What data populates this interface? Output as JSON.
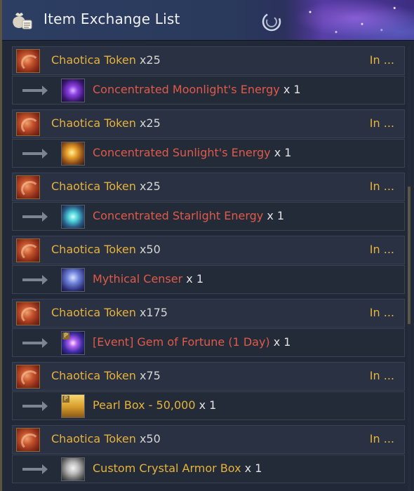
{
  "window": {
    "title": "Item Exchange List",
    "icons": {
      "title": "money-bag-scroll-icon",
      "refresh": "swirl-icon"
    }
  },
  "colors": {
    "gold_text": "#e6b33c",
    "reward_red": "#e05a4a",
    "reward_gold": "#e6b33c",
    "quantity_text": "#e4e4e4",
    "row_bg": "#262d3c",
    "title_bg": "#2c3e63"
  },
  "entries": [
    {
      "cost": {
        "name": "Chaotica Token",
        "qty": "x25",
        "icon": "chaotica-token-icon"
      },
      "status": "In ...",
      "arrow_icon": "arrow-right-icon",
      "reward": {
        "name": "Concentrated Moonlight's Energy",
        "qty": "x 1",
        "icon": "moonlight-energy-icon",
        "color": "#e05a4a"
      }
    },
    {
      "cost": {
        "name": "Chaotica Token",
        "qty": "x25",
        "icon": "chaotica-token-icon"
      },
      "status": "In ...",
      "arrow_icon": "arrow-right-icon",
      "reward": {
        "name": "Concentrated Sunlight's Energy",
        "qty": "x 1",
        "icon": "sunlight-energy-icon",
        "color": "#e05a4a"
      }
    },
    {
      "cost": {
        "name": "Chaotica Token",
        "qty": "x25",
        "icon": "chaotica-token-icon"
      },
      "status": "In ...",
      "arrow_icon": "arrow-right-icon",
      "reward": {
        "name": "Concentrated Starlight Energy",
        "qty": "x 1",
        "icon": "starlight-energy-icon",
        "color": "#e05a4a"
      }
    },
    {
      "cost": {
        "name": "Chaotica Token",
        "qty": "x50",
        "icon": "chaotica-token-icon"
      },
      "status": "In ...",
      "arrow_icon": "arrow-right-icon",
      "reward": {
        "name": "Mythical Censer",
        "qty": "x 1",
        "icon": "censer-icon",
        "color": "#e05a4a"
      }
    },
    {
      "cost": {
        "name": "Chaotica Token",
        "qty": "x175",
        "icon": "chaotica-token-icon"
      },
      "status": "In ...",
      "arrow_icon": "arrow-right-icon",
      "reward": {
        "name": "[Event] Gem of Fortune (1 Day)",
        "qty": "x 1",
        "icon": "gem-of-fortune-icon",
        "color": "#e05a4a",
        "badge": "P"
      }
    },
    {
      "cost": {
        "name": "Chaotica Token",
        "qty": "x75",
        "icon": "chaotica-token-icon"
      },
      "status": "In ...",
      "arrow_icon": "arrow-right-icon",
      "reward": {
        "name": "Pearl Box - 50,000",
        "qty": "x 1",
        "icon": "pearl-box-icon",
        "color": "#e6b33c",
        "badge": "P"
      }
    },
    {
      "cost": {
        "name": "Chaotica Token",
        "qty": "x50",
        "icon": "chaotica-token-icon"
      },
      "status": "In ...",
      "arrow_icon": "arrow-right-icon",
      "reward": {
        "name": "Custom Crystal Armor Box",
        "qty": "x 1",
        "icon": "armor-box-icon",
        "color": "#e6b33c"
      }
    }
  ]
}
